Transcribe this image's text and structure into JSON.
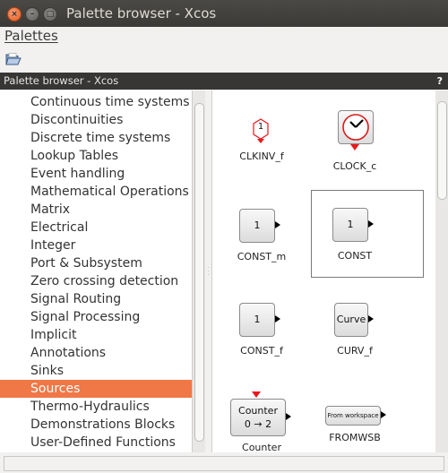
{
  "window": {
    "title": "Palette browser - Xcos"
  },
  "menubar": {
    "items": [
      {
        "label": "Palettes"
      }
    ]
  },
  "panel": {
    "title": "Palette browser - Xcos",
    "help": "?"
  },
  "tree": {
    "items": [
      {
        "label": "Continuous time systems"
      },
      {
        "label": "Discontinuities"
      },
      {
        "label": "Discrete time systems"
      },
      {
        "label": "Lookup Tables"
      },
      {
        "label": "Event handling"
      },
      {
        "label": "Mathematical Operations"
      },
      {
        "label": "Matrix"
      },
      {
        "label": "Electrical"
      },
      {
        "label": "Integer"
      },
      {
        "label": "Port & Subsystem"
      },
      {
        "label": "Zero crossing detection"
      },
      {
        "label": "Signal Routing"
      },
      {
        "label": "Signal Processing"
      },
      {
        "label": "Implicit"
      },
      {
        "label": "Annotations"
      },
      {
        "label": "Sinks"
      },
      {
        "label": "Sources",
        "selected": true
      },
      {
        "label": "Thermo-Hydraulics"
      },
      {
        "label": "Demonstrations Blocks"
      },
      {
        "label": "User-Defined Functions"
      }
    ]
  },
  "blocks": [
    {
      "name": "CLKINV_f",
      "glyph": "1"
    },
    {
      "name": "CLOCK_c",
      "glyph": "clock-icon"
    },
    {
      "name": "CONST_m",
      "glyph": "1"
    },
    {
      "name": "CONST",
      "glyph": "1",
      "selected": true
    },
    {
      "name": "CONST_f",
      "glyph": "1"
    },
    {
      "name": "CURV_f",
      "glyph": "Curve"
    },
    {
      "name": "Counter",
      "glyph_line1": "Counter",
      "glyph_line2": "0 → 2"
    },
    {
      "name": "FROMWSB",
      "glyph": "From workspace"
    }
  ],
  "colors": {
    "selection": "#f07746",
    "titlebar": "#3c3b37",
    "event_port": "#e8191c"
  }
}
